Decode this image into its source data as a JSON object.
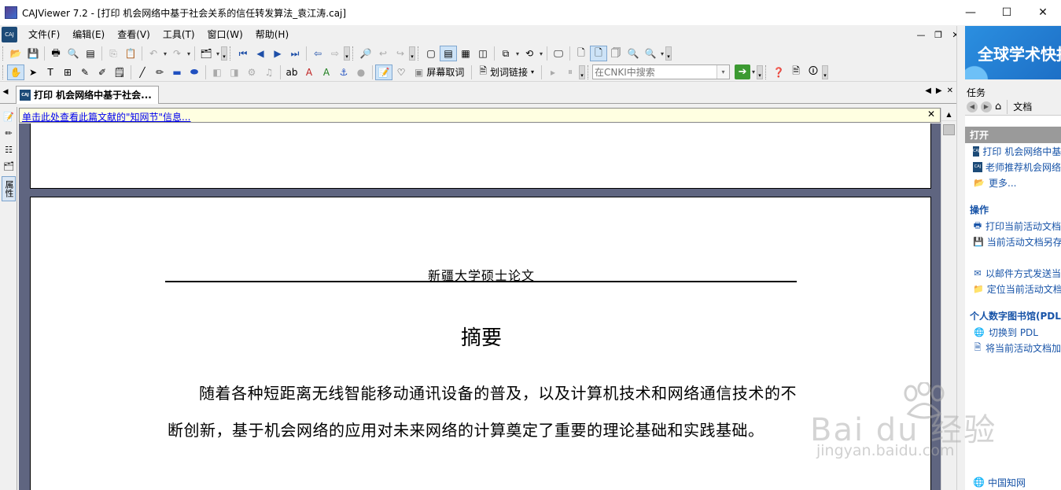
{
  "window": {
    "title": "CAJViewer 7.2 - [打印 机会网络中基于社会关系的信任转发算法_袁江涛.caj]",
    "minimize": "—",
    "maximize": "☐",
    "close": "✕"
  },
  "menu": {
    "logo": "CAJ",
    "items": [
      "文件(F)",
      "编辑(E)",
      "查看(V)",
      "工具(T)",
      "窗口(W)",
      "帮助(H)"
    ],
    "mdi_minimize": "—",
    "mdi_restore": "❐",
    "mdi_close": "✕"
  },
  "toolbar2": {
    "screen_select_label": "屏幕取词",
    "link_label": "划词链接",
    "search_placeholder": "在CNKI中搜索",
    "go_label": "➔"
  },
  "tabs": {
    "prev": "◀",
    "doc_tab_label": "打印 机会网络中基于社会...",
    "tab_icon_text": "CAJ",
    "scroll_left": "◀",
    "scroll_right": "▶",
    "close": "✕"
  },
  "left_strip": {
    "properties_label": "属性"
  },
  "infobar": {
    "link_text": "单击此处查看此篇文献的\"知网节\"信息...",
    "close": "✕"
  },
  "document": {
    "header": "新疆大学硕士论文",
    "title": "摘要",
    "body": "随着各种短距离无线智能移动通讯设备的普及，以及计算机技术和网络通信技术的不断创新，基于机会网络的应用对未来网络的计算奠定了重要的理论基础和实践基础。"
  },
  "right_panel": {
    "banner_text": "全球学术快报",
    "task_header": "任务",
    "nav_home_label": "文档",
    "sections": [
      {
        "title": "打开",
        "items": [
          "打印 机会网络中基",
          "老师推荐机会网络",
          "更多..."
        ]
      },
      {
        "title": "操作",
        "items": [
          "打印当前活动文档",
          "当前活动文档另存",
          "以邮件方式发送当",
          "定位当前活动文档"
        ]
      },
      {
        "title": "个人数字图书馆(PDL)",
        "items": [
          "切换到 PDL",
          "将当前活动文档加"
        ]
      }
    ],
    "bottom_item": "中国知网"
  },
  "watermark": {
    "main": "Bai du 经验",
    "sub": "jingyan.baidu.com"
  },
  "colors": {
    "doc_background": "#5f6580",
    "infobar_bg": "#ffffe1",
    "link_blue": "#1854a8",
    "banner_blue": "#2b8fe0"
  }
}
